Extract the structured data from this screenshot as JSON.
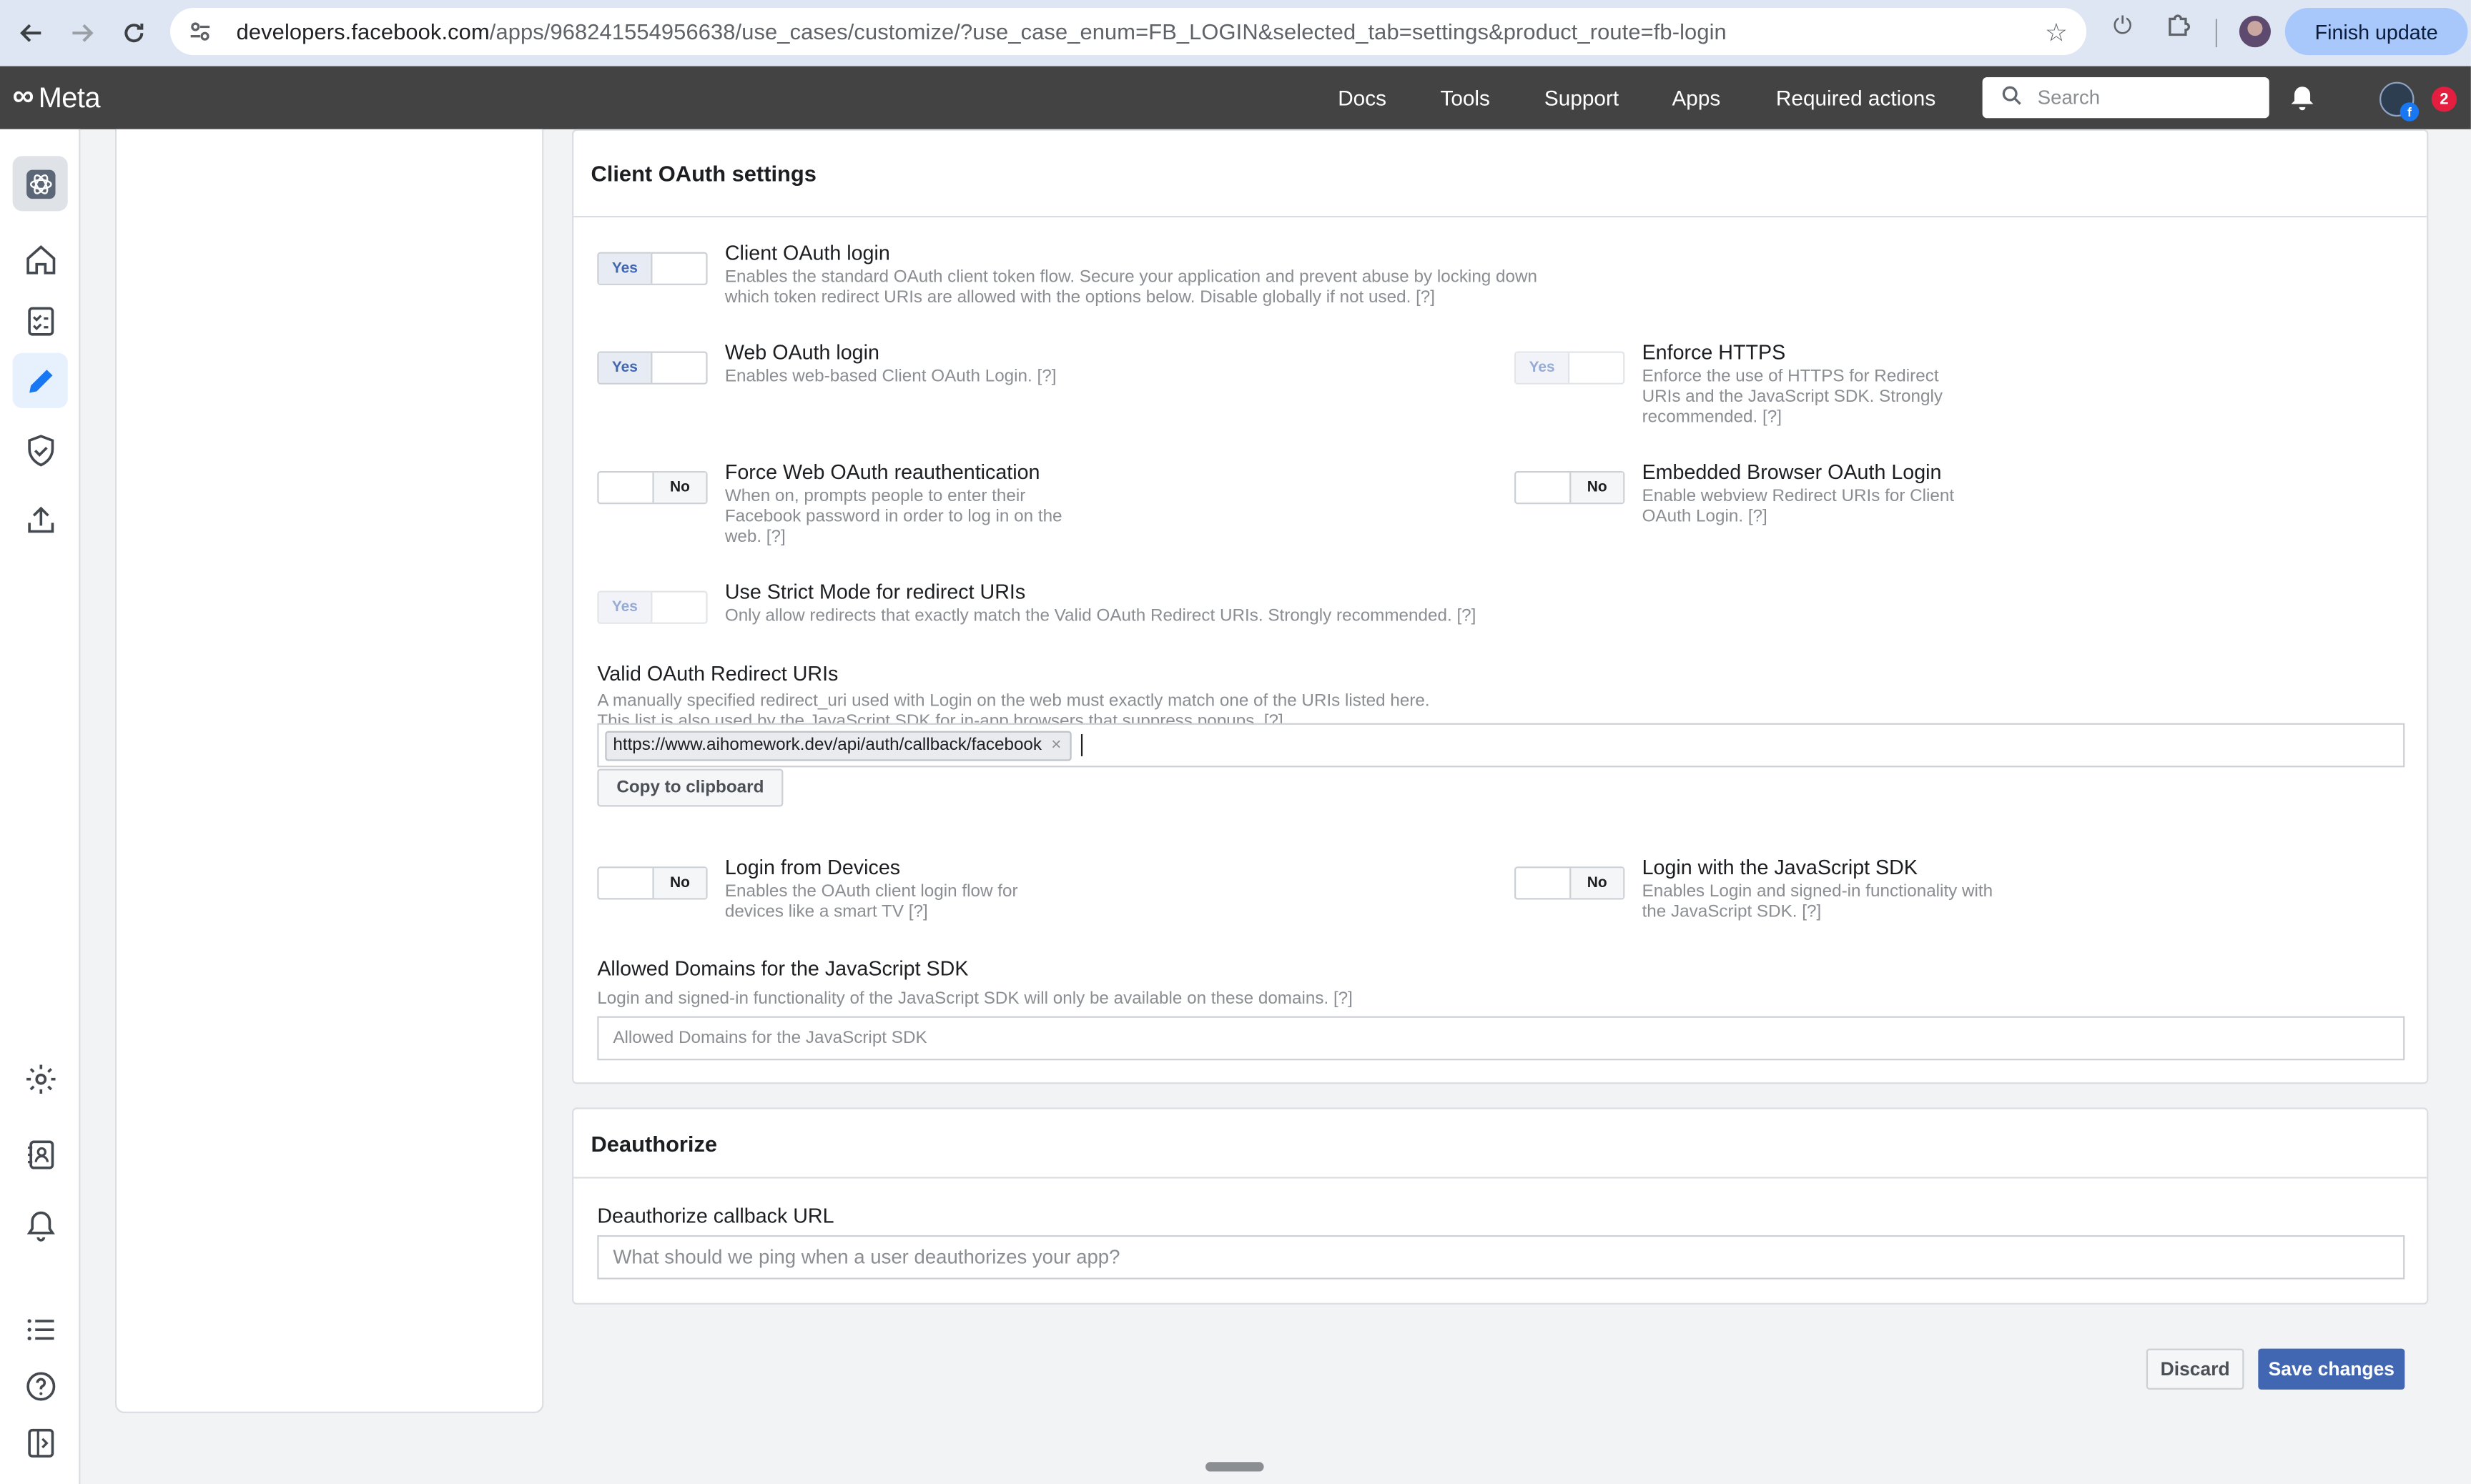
{
  "browser": {
    "url_host": "developers.facebook.com",
    "url_path": "/apps/968241554956638/use_cases/customize/?use_case_enum=FB_LOGIN&selected_tab=settings&product_route=fb-login",
    "finish_update_label": "Finish update"
  },
  "topbar": {
    "brand": "Meta",
    "nav": [
      "Docs",
      "Tools",
      "Support",
      "Apps",
      "Required actions"
    ],
    "search_placeholder": "Search",
    "notification_count": "2"
  },
  "client_oauth": {
    "heading": "Client OAuth settings",
    "options": {
      "client_oauth_login": {
        "toggle": "Yes",
        "title": "Client OAuth login",
        "desc": "Enables the standard OAuth client token flow. Secure your application and prevent abuse by locking down which token redirect URIs are allowed with the options below. Disable globally if not used.  [?]"
      },
      "web_oauth_login": {
        "toggle": "Yes",
        "title": "Web OAuth login",
        "desc": "Enables web-based Client OAuth Login. [?]"
      },
      "enforce_https": {
        "toggle": "Yes",
        "title": "Enforce HTTPS",
        "desc": "Enforce the use of HTTPS for Redirect URIs and the JavaScript SDK. Strongly recommended.  [?]"
      },
      "force_reauth": {
        "toggle": "No",
        "title": "Force Web OAuth reauthentication",
        "desc": "When on, prompts people to enter their Facebook password in order to log in on the web.  [?]"
      },
      "embedded_browser": {
        "toggle": "No",
        "title": "Embedded Browser OAuth Login",
        "desc": "Enable webview Redirect URIs for Client OAuth Login.  [?]"
      },
      "strict_mode": {
        "toggle": "Yes",
        "title": "Use Strict Mode for redirect URIs",
        "desc": "Only allow redirects that exactly match the Valid OAuth Redirect URIs. Strongly recommended.  [?]"
      },
      "login_devices": {
        "toggle": "No",
        "title": "Login from Devices",
        "desc": "Enables the OAuth client login flow for devices like a smart TV [?]"
      },
      "login_js_sdk": {
        "toggle": "No",
        "title": "Login with the JavaScript SDK",
        "desc": "Enables Login and signed-in functionality with the JavaScript SDK.  [?]"
      }
    },
    "redirect_uris": {
      "title": "Valid OAuth Redirect URIs",
      "desc": "A manually specified redirect_uri used with Login on the web must exactly match one of the URIs listed here. This list is also used by the JavaScript SDK for in-app browsers that suppress popups.  [?]",
      "chips": [
        "https://www.aihomework.dev/api/auth/callback/facebook"
      ],
      "chip_remove": "×",
      "copy_label": "Copy to clipboard"
    },
    "allowed_domains": {
      "title": "Allowed Domains for the JavaScript SDK",
      "desc": "Login and signed-in functionality of the JavaScript SDK will only be available on these domains.  [?]",
      "placeholder": "Allowed Domains for the JavaScript SDK"
    }
  },
  "deauthorize": {
    "heading": "Deauthorize",
    "field_label": "Deauthorize callback URL",
    "placeholder": "What should we ping when a user deauthorizes your app?"
  },
  "actions": {
    "discard": "Discard",
    "save": "Save changes"
  }
}
